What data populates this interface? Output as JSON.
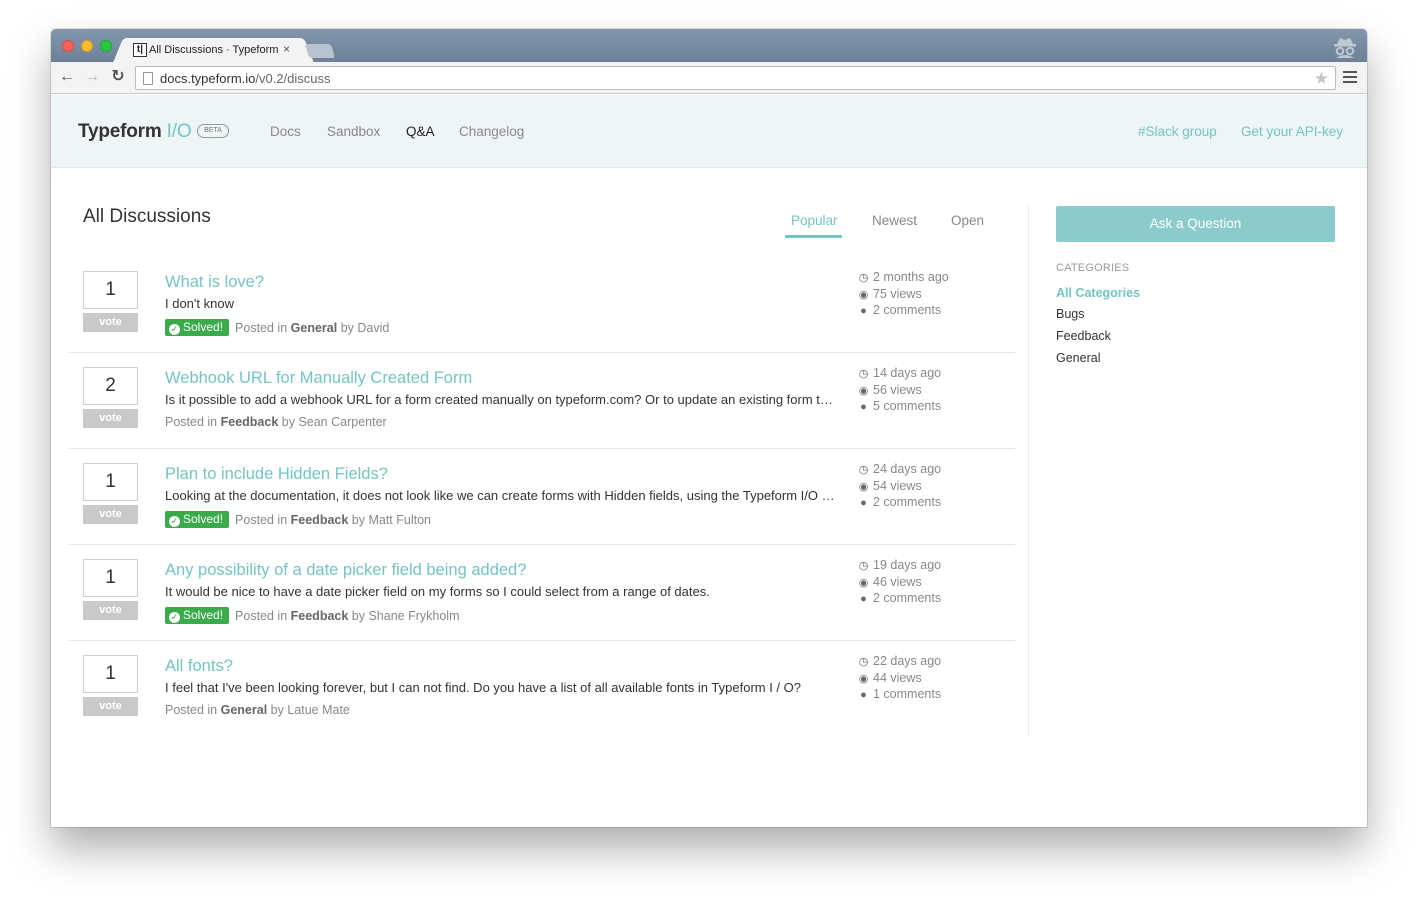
{
  "browser": {
    "tab_title": "All Discussions · Typeform",
    "tab_favicon": "t|",
    "tab_close": "×",
    "url_host": "docs.typeform.io",
    "url_path": "/v0.2/discuss",
    "back_glyph": "←",
    "forward_glyph": "→",
    "reload_glyph": "↻",
    "star_glyph": "★"
  },
  "header": {
    "brand_name": "Typeform",
    "brand_io": "I/O",
    "beta_label": "BETA",
    "nav": [
      "Docs",
      "Sandbox",
      "Q&A",
      "Changelog"
    ],
    "active_nav": "Q&A",
    "slack_link": "#Slack group",
    "api_key_link": "Get your API-key"
  },
  "main": {
    "title": "All Discussions",
    "sort_tabs": [
      "Popular",
      "Newest",
      "Open"
    ],
    "active_sort": "Popular",
    "vote_label": "vote",
    "solved_label": "Solved!",
    "discussions": [
      {
        "votes": "1",
        "title": "What is love?",
        "excerpt": "I don't know",
        "solved": true,
        "posted_in": "Posted in",
        "category": "General",
        "by": "by David",
        "time": "2 months ago",
        "views": "75 views",
        "comments": "2 comments"
      },
      {
        "votes": "2",
        "title": "Webhook URL for Manually Created Form",
        "excerpt": "Is it possible to add a webhook URL for a form created manually on typeform.com? Or to update an existing form to…",
        "solved": false,
        "posted_in": "Posted in",
        "category": "Feedback",
        "by": "by Sean Carpenter",
        "time": "14 days ago",
        "views": "56 views",
        "comments": "5 comments"
      },
      {
        "votes": "1",
        "title": "Plan to include Hidden Fields?",
        "excerpt": "Looking at the documentation, it does not look like we can create forms with Hidden fields, using the Typeform I/O …",
        "solved": true,
        "posted_in": "Posted in",
        "category": "Feedback",
        "by": "by Matt Fulton",
        "time": "24 days ago",
        "views": "54 views",
        "comments": "2 comments"
      },
      {
        "votes": "1",
        "title": "Any possibility of a date picker field being added?",
        "excerpt": "It would be nice to have a date picker field on my forms so I could select from a range of dates.",
        "solved": true,
        "posted_in": "Posted in",
        "category": "Feedback",
        "by": "by Shane Frykholm",
        "time": "19 days ago",
        "views": "46 views",
        "comments": "2 comments"
      },
      {
        "votes": "1",
        "title": "All fonts?",
        "excerpt": "I feel that I've been looking forever, but I can not find. Do you have a list of all available fonts in Typeform I / O?",
        "solved": false,
        "posted_in": "Posted in",
        "category": "General",
        "by": "by Latue Mate",
        "time": "22 days ago",
        "views": "44 views",
        "comments": "1 comments"
      }
    ]
  },
  "sidebar": {
    "ask_button": "Ask a Question",
    "categories_heading": "CATEGORIES",
    "categories": [
      "All Categories",
      "Bugs",
      "Feedback",
      "General"
    ],
    "active_category": "All Categories"
  },
  "icons": {
    "time": "clock-icon",
    "views": "eye-icon",
    "comments": "comment-icon",
    "solved": "check-circle-icon"
  },
  "colors": {
    "accent": "#73c4c6",
    "ask_button": "#8ccbcb",
    "solved": "#3aab4b",
    "header_bg": "#edf5f7"
  }
}
